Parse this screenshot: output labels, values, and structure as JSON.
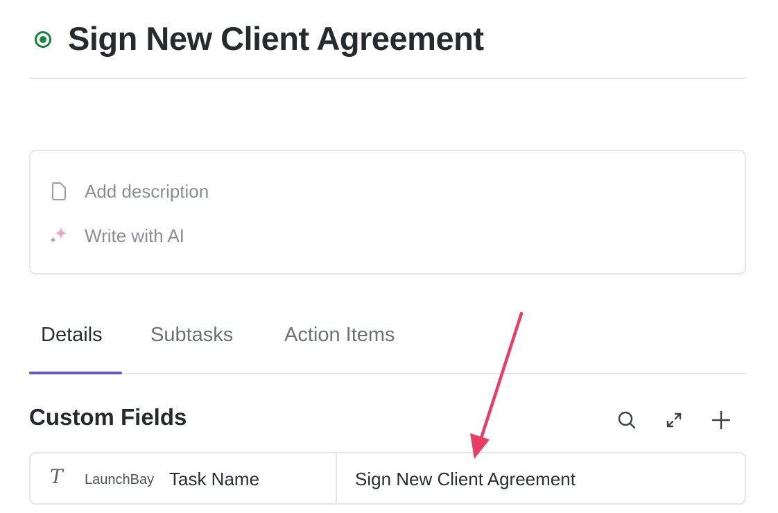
{
  "task": {
    "title": "Sign New Client Agreement",
    "status_color": "#15833a"
  },
  "description": {
    "add_label": "Add description",
    "ai_label": "Write with AI"
  },
  "tabs": [
    {
      "label": "Details",
      "active": true
    },
    {
      "label": "Subtasks",
      "active": false
    },
    {
      "label": "Action Items",
      "active": false
    }
  ],
  "custom_fields": {
    "title": "Custom Fields",
    "actions": [
      "search-icon",
      "expand-icon",
      "plus-icon"
    ],
    "rows": [
      {
        "type_icon": "T",
        "source": "LaunchBay",
        "name": "Task Name",
        "value": "Sign New Client Agreement"
      }
    ]
  },
  "colors": {
    "accent": "#6a56c7",
    "annotation_arrow": "#e83e66"
  }
}
